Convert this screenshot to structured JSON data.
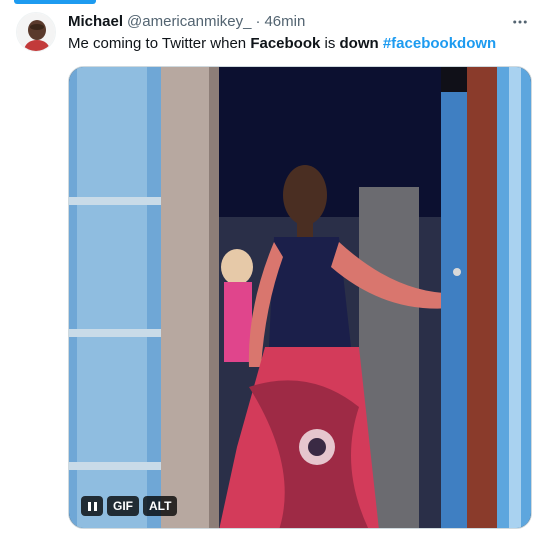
{
  "tweet": {
    "author_name": "Michael",
    "author_handle": "@americanmikey_",
    "separator": "·",
    "timestamp": "46min",
    "text_parts": {
      "part1": "Me coming to Twitter when ",
      "bold1": "Facebook",
      "part2": " is ",
      "bold2": "down",
      "part3": " ",
      "hashtag": "#facebookdown"
    }
  },
  "media": {
    "type": "gif",
    "pause_icon": "pause-icon",
    "gif_badge": "GIF",
    "alt_badge": "ALT"
  },
  "icons": {
    "more": "more-options-icon"
  },
  "colors": {
    "accent": "#1d9bf0",
    "text": "#0f1419",
    "muted": "#536471",
    "border": "#cfd9de"
  }
}
